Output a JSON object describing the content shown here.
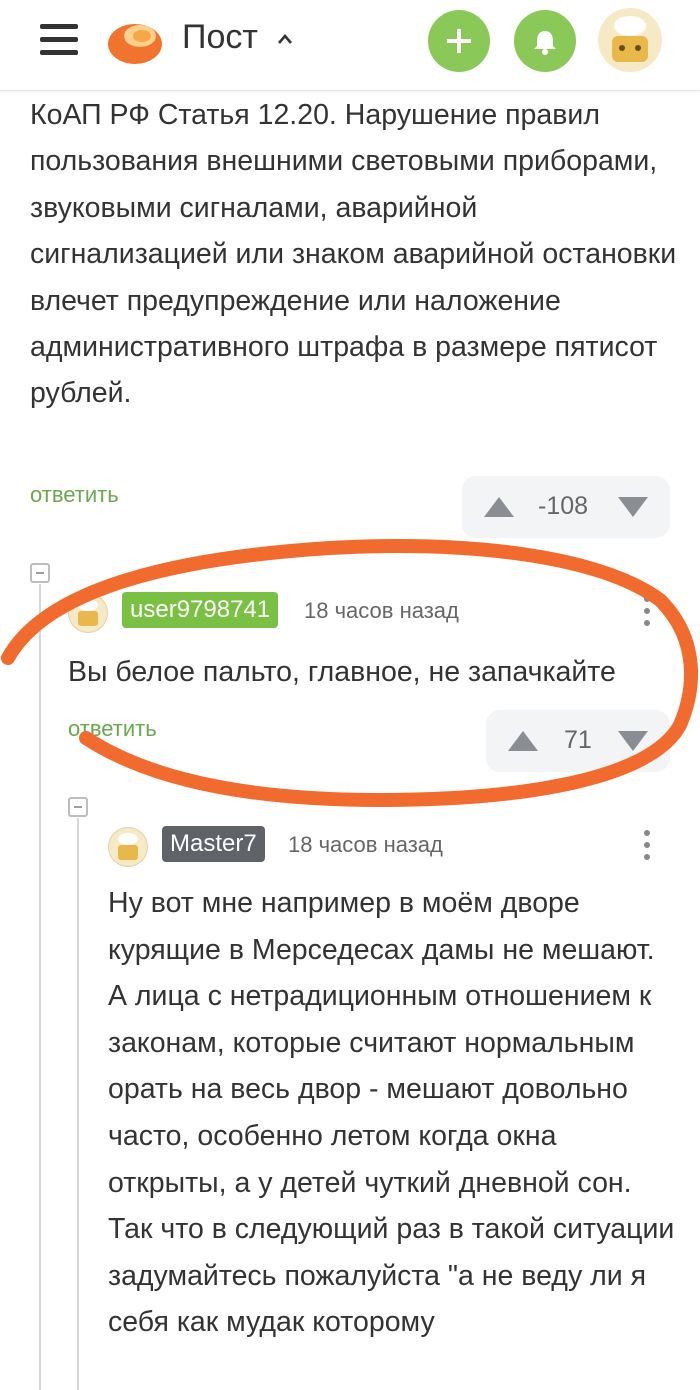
{
  "header": {
    "title": "Пост",
    "menu_icon": "hamburger-icon",
    "logo_icon": "pikabu-logo-icon",
    "add_icon": "plus-icon",
    "notify_icon": "bell-icon",
    "accent": "#8ac858"
  },
  "post": {
    "text": "КоАП РФ Статья 12.20. Нарушение правил пользования внешними световыми приборами, звуковыми сигналами, аварийной сигнализацией или знаком аварийной остановки влечет предупреждение или наложение административного штрафа в размере пятисот рублей.",
    "reply_label": "ответить",
    "score": "-108"
  },
  "comments": [
    {
      "username": "user9798741",
      "time": "18 часов назад",
      "text": "Вы белое пальто, главное, не запачкайте",
      "reply_label": "ответить",
      "score": "71",
      "badge_color": "#7ac143"
    },
    {
      "username": "Master7",
      "time": "18 часов назад",
      "text": "Ну вот мне например в моём дворе курящие в Мерседесах дамы не мешают. А лица с нетрадиционным отношением к законам, которые считают нормальным орать на весь двор - мешают довольно часто, особенно летом когда окна открыты, а у детей чуткий дневной сон.\nТак что в следующий раз в такой ситуации задумайтесь пожалуйста \"а не веду ли я себя как мудак которому",
      "badge_color": "#5f6368"
    }
  ],
  "annotation_color": "#f26b2e"
}
